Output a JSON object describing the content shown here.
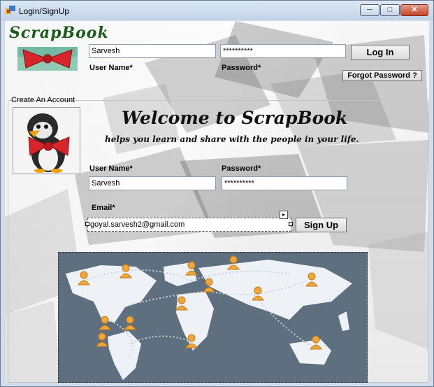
{
  "window": {
    "title": "Login/SignUp",
    "controls": {
      "minimize": "─",
      "maximize": "□",
      "close": "✕"
    }
  },
  "header": {
    "logo_text": "ScrapBook"
  },
  "login": {
    "username_value": "Sarvesh",
    "password_value": "**********",
    "username_label": "User Name*",
    "password_label": "Password*",
    "login_button": "Log In",
    "forgot_button": "Forgot Password ?"
  },
  "signup": {
    "group_title": "Create An Account",
    "welcome": "Welcome to ScrapBook",
    "tagline": "helps you learn and share with the people in your life.",
    "username_label": "User Name*",
    "password_label": "Password*",
    "username_value": "Sarvesh",
    "password_value": "**********",
    "email_label": "Email*",
    "email_value": "goyal.sarvesh2@gmail.com",
    "signup_button": "Sign Up"
  },
  "icons": [
    "app-icon",
    "bow-icon",
    "penguin-icon",
    "world-map-icon",
    "person-marker-icon"
  ],
  "colors": {
    "logo_green": "#1a5a1a",
    "map_background": "#5e6f80",
    "marker_orange": "#f0a63a",
    "bow_red": "#d8252b"
  }
}
